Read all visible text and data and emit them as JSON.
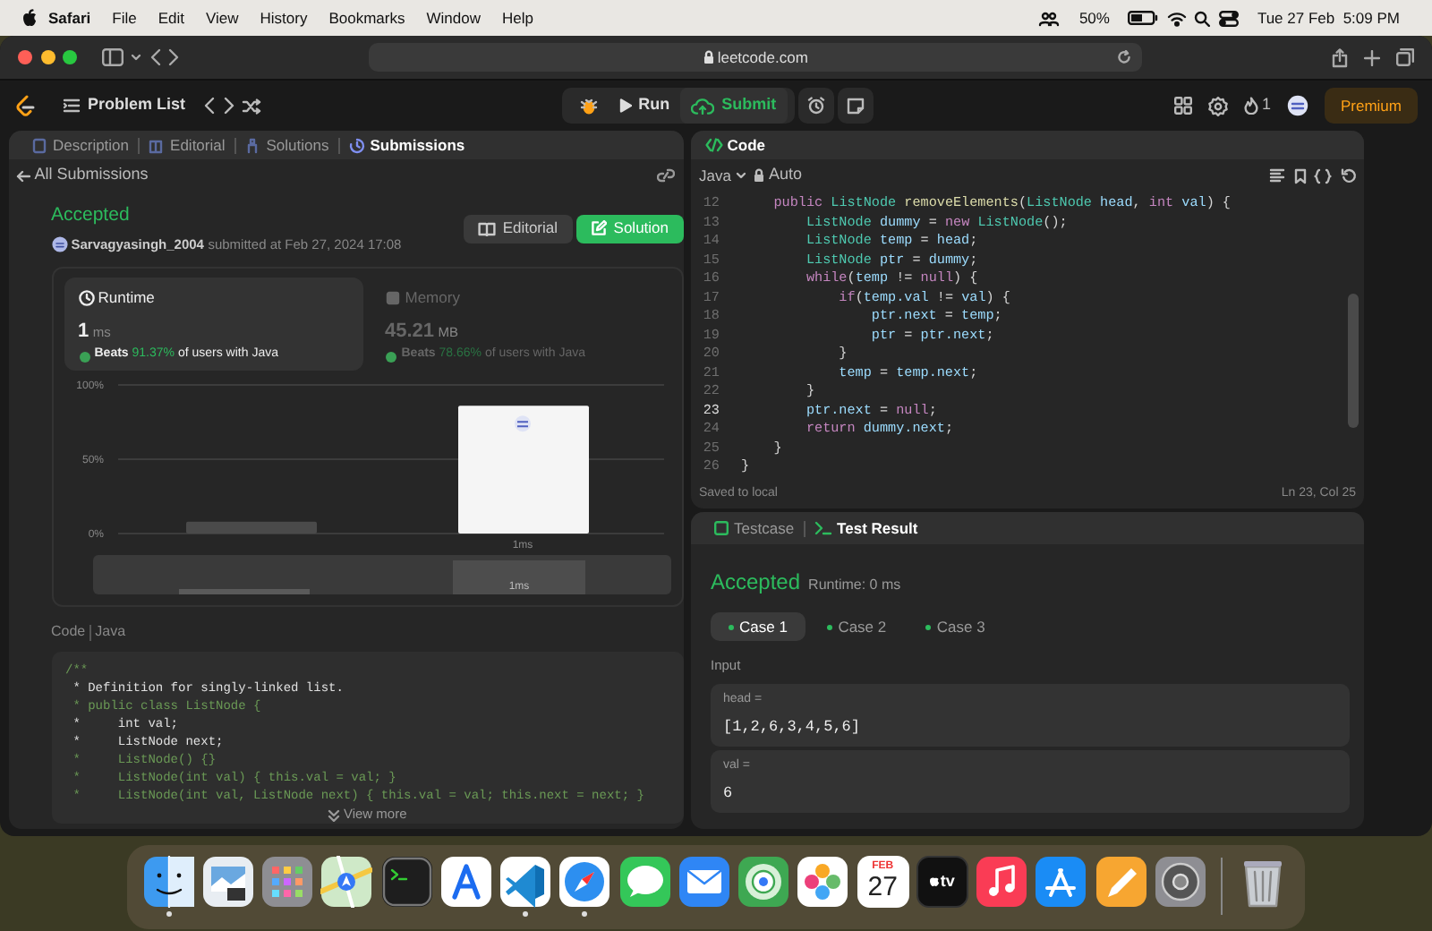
{
  "menubar": {
    "app": "Safari",
    "menus": [
      "File",
      "Edit",
      "View",
      "History",
      "Bookmarks",
      "Window",
      "Help"
    ],
    "battery": "50%",
    "clock": "Tue 27 Feb  5:09 PM"
  },
  "browser": {
    "address": "leetcode.com"
  },
  "nav": {
    "problem_list": "Problem List",
    "run": "Run",
    "submit": "Submit",
    "streak": "1",
    "premium": "Premium"
  },
  "left_panel": {
    "tabs": [
      {
        "label": "Description",
        "selected": false
      },
      {
        "label": "Editorial",
        "selected": false
      },
      {
        "label": "Solutions",
        "selected": false
      },
      {
        "label": "Submissions",
        "selected": true
      }
    ],
    "back_link": "All Submissions",
    "status": "Accepted",
    "user": "Sarvagyasingh_2004",
    "submitted": "submitted at Feb 27, 2024 17:08",
    "buttons": [
      {
        "label": "Editorial",
        "kind": "secondary"
      },
      {
        "label": "Solution",
        "kind": "primary"
      }
    ],
    "stats": [
      {
        "kind": "runtime",
        "title": "Runtime",
        "value": "1",
        "unit": "ms",
        "beats": "Beats",
        "percent": "91.37%",
        "suffix": "of users with Java",
        "selected": true
      },
      {
        "kind": "memory",
        "title": "Memory",
        "value": "45.21",
        "unit": "MB",
        "beats": "Beats",
        "percent": "78.66%",
        "suffix": "of users with Java",
        "selected": false
      }
    ],
    "chart_data": {
      "type": "bar",
      "categories": [
        null,
        "1ms"
      ],
      "values": [
        8,
        86
      ],
      "ylim": [
        0,
        100
      ],
      "yticks": [
        {
          "value": 0,
          "label": "0%"
        },
        {
          "value": 50,
          "label": "50%"
        },
        {
          "value": 100,
          "label": "100%"
        }
      ]
    },
    "navigator_label": "1ms",
    "code_label": "Code",
    "code_lang": "Java",
    "code_lines": [
      {
        "text": "/**",
        "kind": "comment"
      },
      {
        "text": " * Definition for singly-linked list.",
        "kind": "doc"
      },
      {
        "text": " * public class ListNode {",
        "kind": "comment"
      },
      {
        "text": " *     int val;",
        "kind": "doc"
      },
      {
        "text": " *     ListNode next;",
        "kind": "doc"
      },
      {
        "text": " *     ListNode() {}",
        "kind": "comment"
      },
      {
        "text": " *     ListNode(int val) { this.val = val; }",
        "kind": "comment"
      },
      {
        "text": " *     ListNode(int val, ListNode next) { this.val = val; this.next = next; }",
        "kind": "comment"
      }
    ],
    "view_more": "View more"
  },
  "editor": {
    "title": "Code",
    "language": "Java",
    "mode": "Auto",
    "lines": [
      {
        "num": "12",
        "current": false,
        "tokens": [
          {
            "kind": "kw",
            "text": "    public "
          },
          {
            "kind": "type",
            "text": "ListNode "
          },
          {
            "kind": "fn",
            "text": "removeElements"
          },
          {
            "kind": "plain",
            "text": "("
          },
          {
            "kind": "type",
            "text": "ListNode "
          },
          {
            "kind": "var",
            "text": "head"
          },
          {
            "kind": "plain",
            "text": ", "
          },
          {
            "kind": "kw",
            "text": "int "
          },
          {
            "kind": "var",
            "text": "val"
          },
          {
            "kind": "plain",
            "text": ") {"
          }
        ]
      },
      {
        "num": "13",
        "current": false,
        "tokens": [
          {
            "kind": "type",
            "text": "        ListNode "
          },
          {
            "kind": "var",
            "text": "dummy"
          },
          {
            "kind": "plain",
            "text": " = "
          },
          {
            "kind": "kw",
            "text": "new "
          },
          {
            "kind": "type",
            "text": "ListNode"
          },
          {
            "kind": "plain",
            "text": "();"
          }
        ]
      },
      {
        "num": "14",
        "current": false,
        "tokens": [
          {
            "kind": "type",
            "text": "        ListNode "
          },
          {
            "kind": "var",
            "text": "temp"
          },
          {
            "kind": "plain",
            "text": " = "
          },
          {
            "kind": "var",
            "text": "head"
          },
          {
            "kind": "plain",
            "text": ";"
          }
        ]
      },
      {
        "num": "15",
        "current": false,
        "tokens": [
          {
            "kind": "type",
            "text": "        ListNode "
          },
          {
            "kind": "var",
            "text": "ptr"
          },
          {
            "kind": "plain",
            "text": " = "
          },
          {
            "kind": "var",
            "text": "dummy"
          },
          {
            "kind": "plain",
            "text": ";"
          }
        ]
      },
      {
        "num": "16",
        "current": false,
        "tokens": [
          {
            "kind": "kw",
            "text": "        while"
          },
          {
            "kind": "plain",
            "text": "("
          },
          {
            "kind": "var",
            "text": "temp"
          },
          {
            "kind": "plain",
            "text": " != "
          },
          {
            "kind": "kw",
            "text": "null"
          },
          {
            "kind": "plain",
            "text": ") {"
          }
        ]
      },
      {
        "num": "17",
        "current": false,
        "tokens": [
          {
            "kind": "kw",
            "text": "            if"
          },
          {
            "kind": "plain",
            "text": "("
          },
          {
            "kind": "var",
            "text": "temp.val"
          },
          {
            "kind": "plain",
            "text": " != "
          },
          {
            "kind": "var",
            "text": "val"
          },
          {
            "kind": "plain",
            "text": ") {"
          }
        ]
      },
      {
        "num": "18",
        "current": false,
        "tokens": [
          {
            "kind": "var",
            "text": "                ptr.next"
          },
          {
            "kind": "plain",
            "text": " = "
          },
          {
            "kind": "var",
            "text": "temp"
          },
          {
            "kind": "plain",
            "text": ";"
          }
        ]
      },
      {
        "num": "19",
        "current": false,
        "tokens": [
          {
            "kind": "var",
            "text": "                ptr"
          },
          {
            "kind": "plain",
            "text": " = "
          },
          {
            "kind": "var",
            "text": "ptr.next"
          },
          {
            "kind": "plain",
            "text": ";"
          }
        ]
      },
      {
        "num": "20",
        "current": false,
        "tokens": [
          {
            "kind": "plain",
            "text": "            }"
          }
        ]
      },
      {
        "num": "21",
        "current": false,
        "tokens": [
          {
            "kind": "var",
            "text": "            temp"
          },
          {
            "kind": "plain",
            "text": " = "
          },
          {
            "kind": "var",
            "text": "temp.next"
          },
          {
            "kind": "plain",
            "text": ";"
          }
        ]
      },
      {
        "num": "22",
        "current": false,
        "tokens": [
          {
            "kind": "plain",
            "text": "        }"
          }
        ]
      },
      {
        "num": "23",
        "current": true,
        "tokens": [
          {
            "kind": "var",
            "text": "        ptr.next"
          },
          {
            "kind": "plain",
            "text": " = "
          },
          {
            "kind": "kw",
            "text": "null"
          },
          {
            "kind": "plain",
            "text": ";"
          }
        ]
      },
      {
        "num": "24",
        "current": false,
        "tokens": [
          {
            "kind": "kw",
            "text": "        return "
          },
          {
            "kind": "var",
            "text": "dummy.next"
          },
          {
            "kind": "plain",
            "text": ";"
          }
        ]
      },
      {
        "num": "25",
        "current": false,
        "tokens": [
          {
            "kind": "plain",
            "text": "    }"
          }
        ]
      },
      {
        "num": "26",
        "current": false,
        "tokens": [
          {
            "kind": "plain",
            "text": "}"
          }
        ]
      }
    ],
    "saved": "Saved to local",
    "cursor": "Ln 23, Col 25"
  },
  "test_panel": {
    "tabs": [
      {
        "label": "Testcase",
        "selected": false
      },
      {
        "label": "Test Result",
        "selected": true
      }
    ],
    "status": "Accepted",
    "runtime": "Runtime: 0 ms",
    "cases": [
      {
        "label": "Case 1",
        "selected": true
      },
      {
        "label": "Case 2",
        "selected": false
      },
      {
        "label": "Case 3",
        "selected": false
      }
    ],
    "input_label": "Input",
    "inputs": [
      {
        "name": "head =",
        "value": "[1,2,6,3,4,5,6]"
      },
      {
        "name": "val =",
        "value": "6"
      }
    ]
  },
  "dock": [
    {
      "kind": "finder",
      "running": true
    },
    {
      "kind": "preview",
      "running": false
    },
    {
      "kind": "launchpad",
      "running": false
    },
    {
      "kind": "maps",
      "running": false
    },
    {
      "kind": "terminal",
      "running": false
    },
    {
      "kind": "instruments",
      "running": false
    },
    {
      "kind": "vscode",
      "running": true
    },
    {
      "kind": "safari",
      "running": true
    },
    {
      "kind": "messages",
      "running": false
    },
    {
      "kind": "mail",
      "running": false
    },
    {
      "kind": "findmy",
      "running": false
    },
    {
      "kind": "photos",
      "running": false
    },
    {
      "kind": "calendar",
      "running": false,
      "month": "FEB",
      "day": "27"
    },
    {
      "kind": "tv",
      "running": false,
      "label": "tv"
    },
    {
      "kind": "music",
      "running": false
    },
    {
      "kind": "appstore",
      "running": false
    },
    {
      "kind": "pages",
      "running": false
    },
    {
      "kind": "settings",
      "running": false
    },
    {
      "kind": "trash",
      "running": false
    }
  ]
}
